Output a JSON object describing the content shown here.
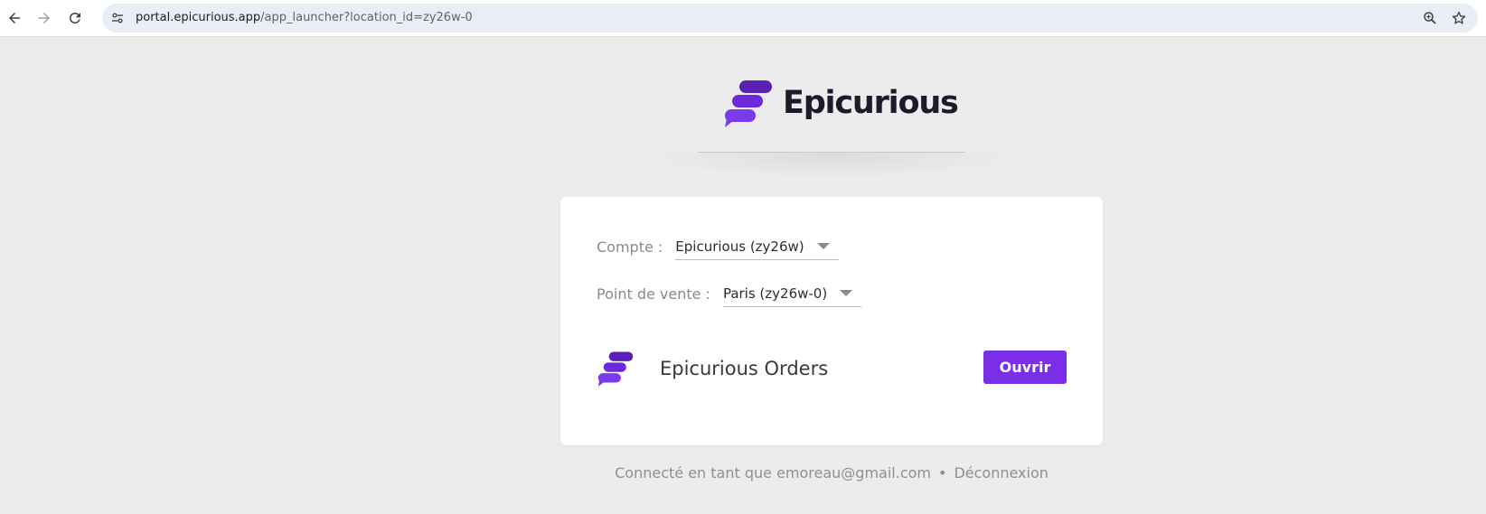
{
  "browser": {
    "url_host": "portal.epicurious.app",
    "url_path": "/app_launcher?location_id=zy26w-0"
  },
  "brand": {
    "name": "Epicurious",
    "accent_color": "#7a2fe6"
  },
  "card": {
    "account_label": "Compte :",
    "account_value": "Epicurious (zy26w)",
    "location_label": "Point de vente :",
    "location_value": "Paris (zy26w-0)",
    "app_name": "Epicurious Orders",
    "open_label": "Ouvrir"
  },
  "footer": {
    "logged_in_text": "Connecté en tant que emoreau@gmail.com",
    "separator": "•",
    "logout_label": "Déconnexion"
  },
  "icons": {
    "back": "arrow-left-icon",
    "forward": "arrow-right-icon",
    "reload": "reload-icon",
    "site_info": "tune-icon",
    "zoom": "zoom-icon",
    "bookmark": "star-icon"
  }
}
